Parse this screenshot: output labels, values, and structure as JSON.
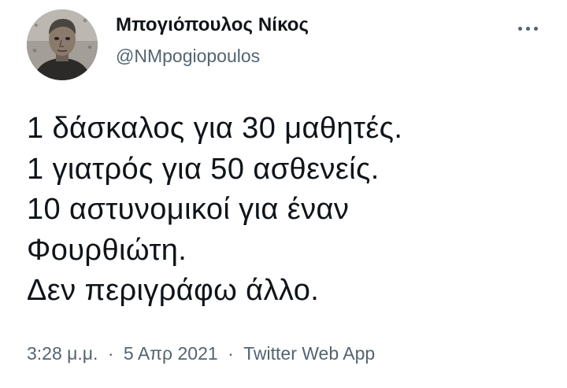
{
  "tweet": {
    "author": {
      "display_name": "Μπογιόπουλος Νίκος",
      "handle": "@NMpogiopoulos",
      "avatar_icon": "profile-photo"
    },
    "more_icon": "more-options-icon",
    "text_lines": [
      "1 δάσκαλος για 30 μαθητές.",
      "1 γιατρός για 50 ασθενείς.",
      "10 αστυνομικοί για έναν",
      "Φουρθιώτη.",
      "Δεν περιγράφω άλλο."
    ],
    "meta": {
      "time": "3:28 μ.μ.",
      "separator": "·",
      "date": "5 Απρ 2021",
      "source": "Twitter Web App"
    }
  }
}
